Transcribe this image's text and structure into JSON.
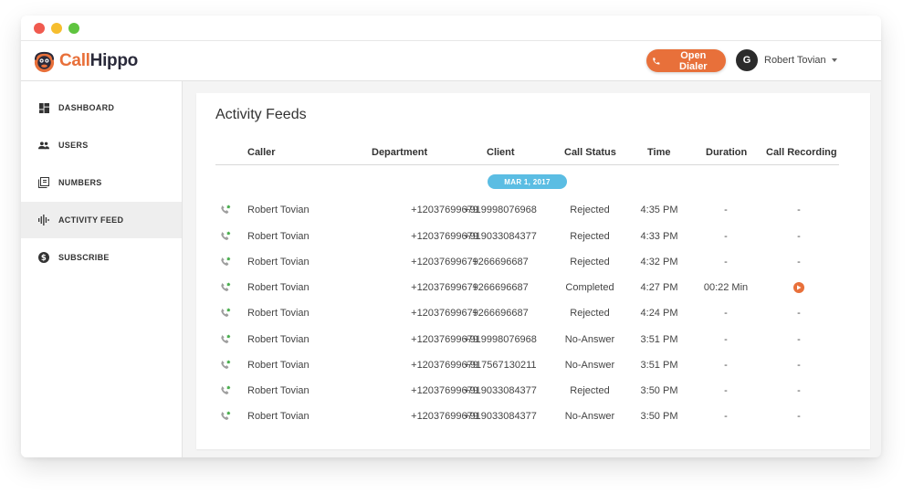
{
  "window": {
    "controls": [
      "close",
      "minimize",
      "maximize"
    ]
  },
  "brand": {
    "name_part1": "Call",
    "name_part2": "Hippo",
    "accent_color": "#e8703a"
  },
  "header": {
    "open_dialer_label": "Open Dialer",
    "user_initial": "G",
    "user_name": "Robert Tovian"
  },
  "sidebar": {
    "items": [
      {
        "label": "DASHBOARD",
        "icon": "dashboard-icon",
        "active": false
      },
      {
        "label": "USERS",
        "icon": "users-icon",
        "active": false
      },
      {
        "label": "NUMBERS",
        "icon": "numbers-icon",
        "active": false
      },
      {
        "label": "ACTIVITY FEED",
        "icon": "activity-feed-icon",
        "active": true
      },
      {
        "label": "SUBSCRIBE",
        "icon": "dollar-icon",
        "active": false
      }
    ]
  },
  "main": {
    "title": "Activity Feeds",
    "columns": [
      "Caller",
      "Department",
      "Client",
      "Call Status",
      "Time",
      "Duration",
      "Call Recording"
    ],
    "date_label": "MAR 1, 2017",
    "rows": [
      {
        "caller": "Robert Tovian",
        "department": "+12037699679",
        "client": "+919998076968",
        "status": "Rejected",
        "time": "4:35 PM",
        "duration": "-",
        "recording": "-"
      },
      {
        "caller": "Robert Tovian",
        "department": "+12037699679",
        "client": "+919033084377",
        "status": "Rejected",
        "time": "4:33 PM",
        "duration": "-",
        "recording": "-"
      },
      {
        "caller": "Robert Tovian",
        "department": "+12037699679",
        "client": "+266696687",
        "status": "Rejected",
        "time": "4:32 PM",
        "duration": "-",
        "recording": "-"
      },
      {
        "caller": "Robert Tovian",
        "department": "+12037699679",
        "client": "+266696687",
        "status": "Completed",
        "time": "4:27 PM",
        "duration": "00:22 Min",
        "recording": "play-icon"
      },
      {
        "caller": "Robert Tovian",
        "department": "+12037699679",
        "client": "+266696687",
        "status": "Rejected",
        "time": "4:24 PM",
        "duration": "-",
        "recording": "-"
      },
      {
        "caller": "Robert Tovian",
        "department": "+12037699679",
        "client": "+919998076968",
        "status": "No-Answer",
        "time": "3:51 PM",
        "duration": "-",
        "recording": "-"
      },
      {
        "caller": "Robert Tovian",
        "department": "+12037699679",
        "client": "+917567130211",
        "status": "No-Answer",
        "time": "3:51 PM",
        "duration": "-",
        "recording": "-"
      },
      {
        "caller": "Robert Tovian",
        "department": "+12037699679",
        "client": "+919033084377",
        "status": "Rejected",
        "time": "3:50 PM",
        "duration": "-",
        "recording": "-"
      },
      {
        "caller": "Robert Tovian",
        "department": "+12037699679",
        "client": "+919033084377",
        "status": "No-Answer",
        "time": "3:50 PM",
        "duration": "-",
        "recording": "-"
      }
    ]
  }
}
